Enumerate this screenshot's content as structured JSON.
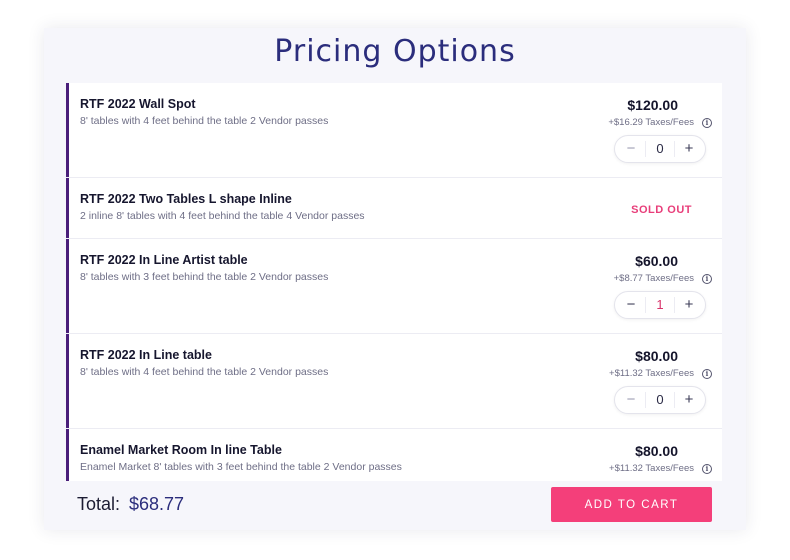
{
  "title": "Pricing Options",
  "items": [
    {
      "name": "RTF 2022 Wall Spot",
      "description": "8' tables with 4 feet behind the table 2 Vendor passes",
      "price": "$120.00",
      "fees": "+$16.29 Taxes/Fees",
      "quantity": "0",
      "status": "available"
    },
    {
      "name": "RTF 2022 Two Tables L shape Inline",
      "description": "2 inline 8' tables with 4 feet behind the table 4 Vendor passes",
      "status": "sold_out",
      "sold_out_label": "SOLD OUT"
    },
    {
      "name": "RTF 2022 In Line Artist table",
      "description": "8' tables with 3 feet behind the table 2 Vendor passes",
      "price": "$60.00",
      "fees": "+$8.77 Taxes/Fees",
      "quantity": "1",
      "status": "available"
    },
    {
      "name": "RTF 2022 In Line table",
      "description": "8' tables with 4 feet behind the table 2 Vendor passes",
      "price": "$80.00",
      "fees": "+$11.32 Taxes/Fees",
      "quantity": "0",
      "status": "available"
    },
    {
      "name": "Enamel Market Room In line Table",
      "description": "Enamel Market 8' tables with 3 feet behind the table 2 Vendor passes",
      "price": "$80.00",
      "fees": "+$11.32 Taxes/Fees",
      "status": "available"
    }
  ],
  "stepper": {
    "minus": "−",
    "plus": "+"
  },
  "info_icon_glyph": "i",
  "footer": {
    "total_label": "Total:",
    "total_value": "$68.77",
    "add_to_cart_label": "ADD TO CART"
  },
  "colors": {
    "accent": "#f43f7a",
    "title": "#2b2d7c",
    "item_border": "#4a1f7a",
    "sold_out": "#e83e7a"
  },
  "icons": [
    "info-icon",
    "minus-icon",
    "plus-icon"
  ]
}
